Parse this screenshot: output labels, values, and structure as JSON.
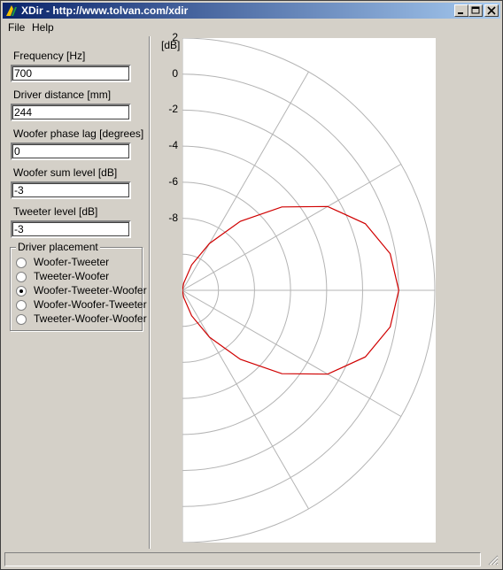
{
  "window": {
    "title": "XDir - http://www.tolvan.com/xdir"
  },
  "menu": [
    "File",
    "Help"
  ],
  "fields": [
    {
      "label": "Frequency [Hz]",
      "value": "700"
    },
    {
      "label": "Driver distance [mm]",
      "value": "244"
    },
    {
      "label": "Woofer phase lag [degrees]",
      "value": "0"
    },
    {
      "label": "Woofer sum level [dB]",
      "value": "-3"
    },
    {
      "label": "Tweeter level [dB]",
      "value": "-3"
    }
  ],
  "placement": {
    "title": "Driver placement",
    "options": [
      "Woofer-Tweeter",
      "Tweeter-Woofer",
      "Woofer-Tweeter-Woofer",
      "Woofer-Woofer-Tweeter",
      "Tweeter-Woofer-Woofer"
    ],
    "selected": "Woofer-Tweeter-Woofer"
  },
  "chart_data": {
    "type": "line",
    "subtype": "polar-half",
    "ylabel": "[dB]",
    "tick_labels": [
      "2",
      "0",
      "-2",
      "-4",
      "-6",
      "-8"
    ],
    "radial_range_db": [
      -12,
      2
    ],
    "ring_step_db": 2,
    "spoke_step_deg": 30,
    "grid": true,
    "series": [
      {
        "color": "#d00000",
        "angle_deg": [
          0,
          10,
          20,
          30,
          40,
          50,
          60,
          70,
          80,
          90
        ],
        "level_db": [
          0,
          -0.3,
          -1.2,
          -2.7,
          -4.8,
          -7,
          -9,
          -10.5,
          -11.6,
          -12
        ]
      }
    ],
    "colors": {
      "grid": "#b4b4b4",
      "curve": "#d00000"
    }
  }
}
